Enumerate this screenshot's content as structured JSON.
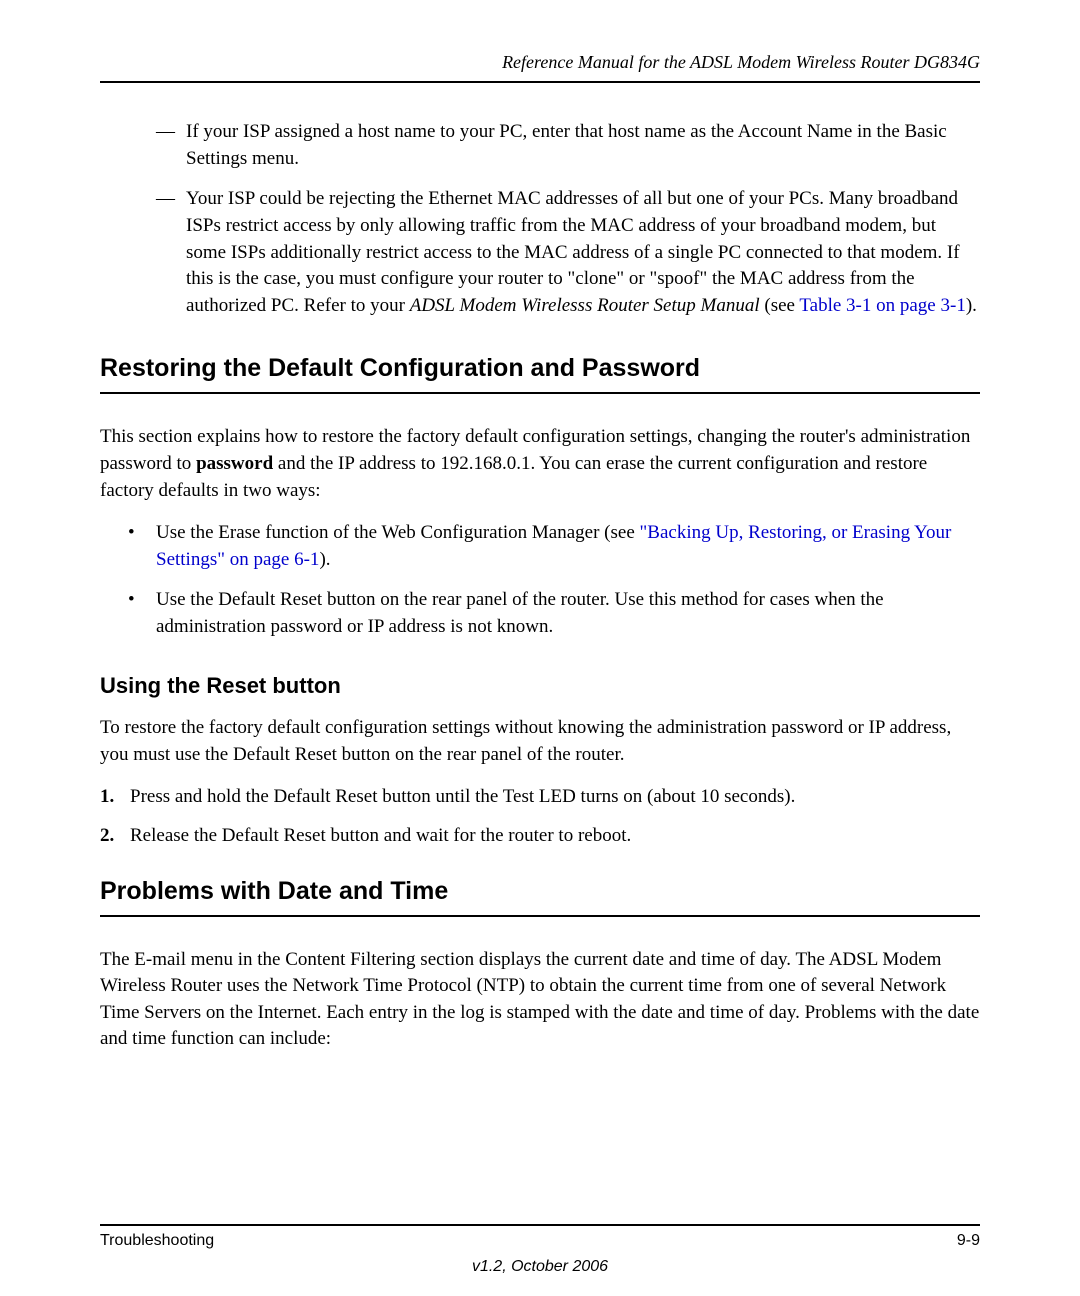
{
  "header_title": "Reference Manual for the ADSL Modem Wireless Router DG834G",
  "dash_items": {
    "item1": "If your ISP assigned a host name to your PC, enter that host name as the Account Name in the Basic Settings menu.",
    "item2_part1": "Your ISP could be rejecting the Ethernet MAC addresses of all but one of your PCs. Many broadband ISPs restrict access by only allowing traffic from the MAC address of your broadband modem, but some ISPs additionally restrict access to the MAC address of a single PC connected to that modem. If this is the case, you must configure your router to \"clone\" or \"spoof\" the MAC address from the authorized PC. Refer to your ",
    "item2_italic": "ADSL Modem Wirelesss Router Setup Manual",
    "item2_part2": " (see ",
    "item2_link": "Table 3-1 on page 3-1",
    "item2_part3": ")."
  },
  "h1_restoring": "Restoring the Default Configuration and Password",
  "restoring_intro_part1": "This section explains how to restore the factory default configuration settings, changing the router's administration password to ",
  "restoring_intro_bold": "password",
  "restoring_intro_part2": " and the IP address to 192.168.0.1. You can erase the current configuration and restore factory defaults in two ways:",
  "bullets": {
    "b1_part1": "Use the Erase function of the Web Configuration Manager (see ",
    "b1_link": "\"Backing Up, Restoring, or Erasing Your Settings\" on page 6-1",
    "b1_part2": ").",
    "b2": "Use the Default Reset button on the rear panel of the router. Use this method for cases when the administration password or IP address is not known."
  },
  "h2_reset": "Using the Reset button",
  "reset_intro": "To restore the factory default configuration settings without knowing the administration password or IP address, you must use the Default Reset button on the rear panel of the router.",
  "steps": {
    "s1_num": "1.",
    "s1_text": "Press and hold the Default Reset button until the Test LED turns on (about 10 seconds).",
    "s2_num": "2.",
    "s2_text": "Release the Default Reset button and wait for the router to reboot."
  },
  "h1_datetime": "Problems with Date and Time",
  "datetime_intro": "The E-mail menu in the Content Filtering section displays the current date and time of day. The ADSL Modem Wireless Router uses the Network Time Protocol (NTP) to obtain the current time from one of several Network Time Servers on the Internet. Each entry in the log is stamped with the date and time of day. Problems with the date and time function can include:",
  "footer": {
    "left": "Troubleshooting",
    "right": "9-9",
    "center": "v1.2, October 2006"
  }
}
